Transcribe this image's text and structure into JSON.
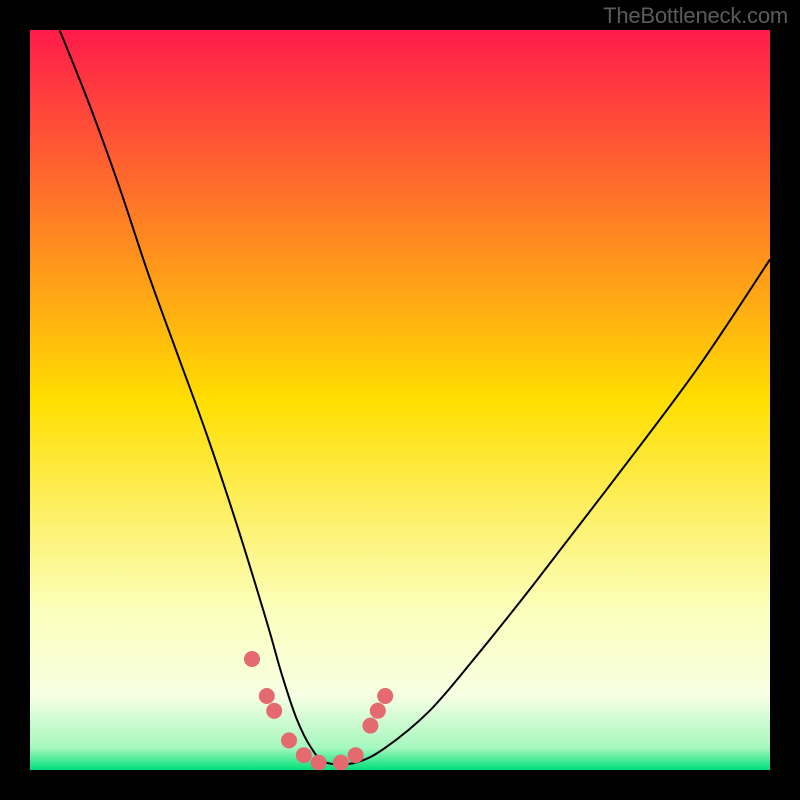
{
  "watermark": "TheBottleneck.com",
  "chart_data": {
    "type": "line",
    "title": "",
    "xlabel": "",
    "ylabel": "",
    "xlim": [
      0,
      100
    ],
    "ylim": [
      0,
      100
    ],
    "grid": false,
    "legend": null,
    "background_gradient": {
      "stops": [
        {
          "offset": 0.0,
          "color": "#ff1b4b"
        },
        {
          "offset": 0.5,
          "color": "#ffde00"
        },
        {
          "offset": 0.78,
          "color": "#fcffba"
        },
        {
          "offset": 0.9,
          "color": "#f6ffe3"
        },
        {
          "offset": 0.97,
          "color": "#a5f7bf"
        },
        {
          "offset": 1.0,
          "color": "#00e07a"
        }
      ]
    },
    "series": [
      {
        "name": "bottleneck-curve",
        "color": "#000000",
        "x": [
          4,
          8,
          12,
          16,
          20,
          24,
          28,
          32,
          34,
          36,
          38,
          40,
          44,
          48,
          54,
          60,
          68,
          78,
          90,
          100
        ],
        "values": [
          100,
          90,
          79,
          67,
          56,
          45,
          33,
          20,
          13,
          7,
          3,
          1,
          1,
          3,
          8,
          15,
          25,
          38,
          54,
          69
        ]
      },
      {
        "name": "bottleneck-zone-markers",
        "type": "scatter",
        "color": "#e46a6f",
        "marker_radius": 8,
        "x": [
          30,
          32,
          33,
          35,
          37,
          39,
          42,
          44,
          46,
          47,
          48
        ],
        "values": [
          15,
          10,
          8,
          4,
          2,
          1,
          1,
          2,
          6,
          8,
          10
        ]
      }
    ]
  }
}
